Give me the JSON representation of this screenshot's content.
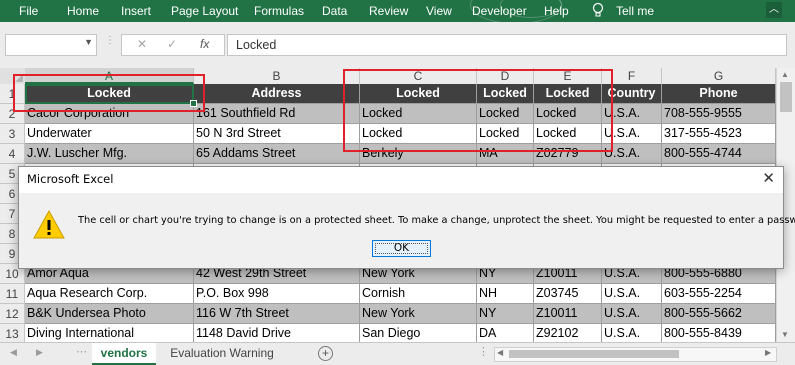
{
  "ribbon": {
    "tabs": [
      "File",
      "Home",
      "Insert",
      "Page Layout",
      "Formulas",
      "Data",
      "Review",
      "View",
      "Developer",
      "Help"
    ],
    "tell_me": "Tell me",
    "accent": "#217346"
  },
  "formula_bar": {
    "name_box": "",
    "value": "Locked",
    "fx": "fx",
    "cancel": "✕",
    "enter": "✓"
  },
  "columns": [
    "A",
    "B",
    "C",
    "D",
    "E",
    "F",
    "G"
  ],
  "rows": [
    {
      "num": "1",
      "cells": [
        "Locked",
        "Address",
        "Locked",
        "Locked",
        "Locked",
        "Country",
        "Phone"
      ],
      "header": true
    },
    {
      "num": "2",
      "cells": [
        "Cacor Corporation",
        "161 Southfield Rd",
        "Locked",
        "Locked",
        "Locked",
        "U.S.A.",
        "708-555-9555"
      ]
    },
    {
      "num": "3",
      "cells": [
        "Underwater",
        "50 N 3rd Street",
        "Locked",
        "Locked",
        "Locked",
        "U.S.A.",
        "317-555-4523"
      ]
    },
    {
      "num": "4",
      "cells": [
        "J.W.  Luscher Mfg.",
        "65 Addams Street",
        "Berkely",
        "MA",
        "Z02779",
        "U.S.A.",
        "800-555-4744"
      ]
    },
    {
      "num": "5",
      "cells": [
        "",
        "",
        "",
        "",
        "",
        "",
        ""
      ]
    },
    {
      "num": "6",
      "cells": [
        "",
        "",
        "",
        "",
        "",
        "",
        ""
      ]
    },
    {
      "num": "7",
      "cells": [
        "",
        "",
        "",
        "",
        "",
        "",
        ""
      ]
    },
    {
      "num": "8",
      "cells": [
        "",
        "",
        "",
        "",
        "",
        "",
        ""
      ]
    },
    {
      "num": "9",
      "cells": [
        "",
        "",
        "",
        "",
        "",
        "",
        ""
      ]
    },
    {
      "num": "10",
      "cells": [
        "Amor Aqua",
        "42 West 29th Street",
        "New York",
        "NY",
        "Z10011",
        "U.S.A.",
        "800-555-6880"
      ]
    },
    {
      "num": "11",
      "cells": [
        "Aqua Research Corp.",
        "P.O. Box 998",
        "Cornish",
        "NH",
        "Z03745",
        "U.S.A.",
        "603-555-2254"
      ]
    },
    {
      "num": "12",
      "cells": [
        "B&K Undersea Photo",
        "116 W 7th Street",
        "New York",
        "NY",
        "Z10011",
        "U.S.A.",
        "800-555-5662"
      ]
    },
    {
      "num": "13",
      "cells": [
        "Diving International",
        "1148 David Drive",
        "San Diego",
        "DA",
        "Z92102",
        "U.S.A.",
        "800-555-8439"
      ]
    }
  ],
  "sheet_tabs": [
    {
      "label": "vendors",
      "active": true
    },
    {
      "label": "Evaluation Warning",
      "active": false
    }
  ],
  "add_sheet": "+",
  "dialog": {
    "title": "Microsoft Excel",
    "close": "✕",
    "icon": "warning-icon",
    "message": "The cell or chart you're trying to change is on a protected sheet. To make a change, unprotect the sheet. You might be requested to enter a password.",
    "ok": "OK"
  }
}
